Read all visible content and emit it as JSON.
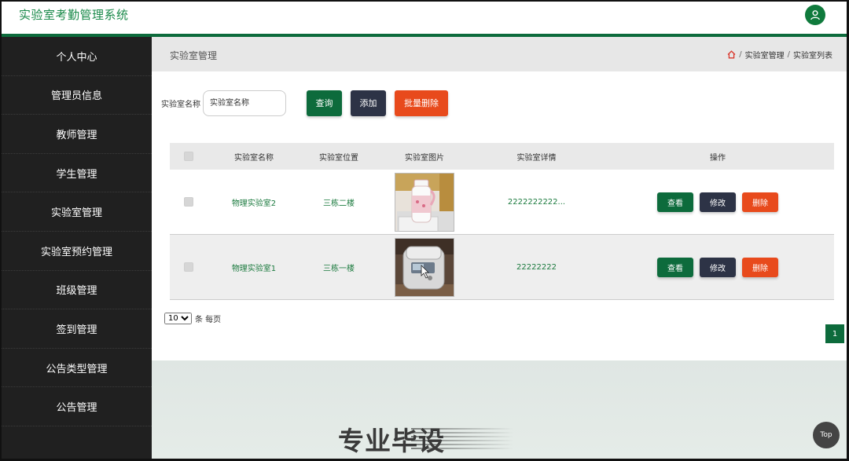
{
  "header": {
    "app_title": "实验室考勤管理系统",
    "user_icon": "user-icon",
    "accent_color": "#0d6b3c"
  },
  "sidebar": {
    "items": [
      {
        "label": "个人中心"
      },
      {
        "label": "管理员信息"
      },
      {
        "label": "教师管理"
      },
      {
        "label": "学生管理"
      },
      {
        "label": "实验室管理"
      },
      {
        "label": "实验室预约管理"
      },
      {
        "label": "班级管理"
      },
      {
        "label": "签到管理"
      },
      {
        "label": "公告类型管理"
      },
      {
        "label": "公告管理"
      }
    ]
  },
  "breadcrumb": {
    "title": "实验室管理",
    "home_icon": "home-icon",
    "path": [
      "实验室管理",
      "实验室列表"
    ],
    "separator": "/"
  },
  "search": {
    "label": "实验室名称",
    "placeholder": "实验室名称",
    "value": "",
    "query_label": "查询",
    "add_label": "添加",
    "batch_delete_label": "批量删除"
  },
  "table": {
    "columns": [
      "实验室名称",
      "实验室位置",
      "实验室图片",
      "实验室详情",
      "操作"
    ],
    "rows": [
      {
        "name": "物理实验室2",
        "location": "三栋二楼",
        "image": "soymilk-maker-photo",
        "detail": "2222222222...",
        "view": "查看",
        "edit": "修改",
        "delete": "删除"
      },
      {
        "name": "物理实验室1",
        "location": "三栋一楼",
        "image": "rice-cooker-photo",
        "detail": "22222222",
        "view": "查看",
        "edit": "修改",
        "delete": "删除"
      }
    ]
  },
  "pagination": {
    "page_size": "10",
    "page_size_options": [
      "10"
    ],
    "suffix": "条 每页",
    "current_page": "1"
  },
  "footer": {
    "watermark": "专业毕设",
    "top_label": "Top"
  }
}
